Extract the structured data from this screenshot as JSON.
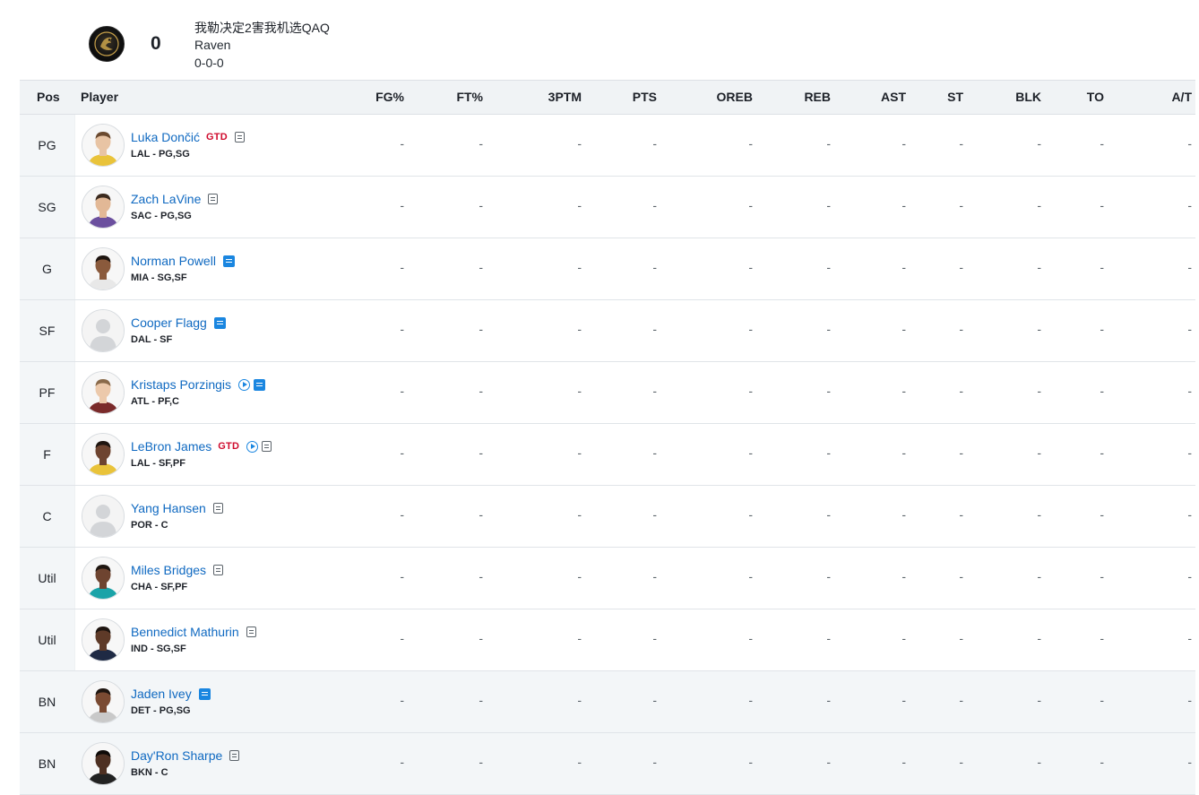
{
  "team": {
    "name": "我勒决定2害我机选QAQ",
    "owner": "Raven",
    "score": "0",
    "record": "0-0-0",
    "logo_icon": "raven-logo-icon"
  },
  "columns": {
    "pos": "Pos",
    "player": "Player",
    "stats": [
      "FG%",
      "FT%",
      "3PTM",
      "PTS",
      "OREB",
      "REB",
      "AST",
      "ST",
      "BLK",
      "TO",
      "A/T"
    ]
  },
  "players": [
    {
      "pos": "PG",
      "name": "Luka Dončić",
      "team_pos": "LAL - PG,SG",
      "status": "GTD",
      "video": false,
      "note": "plain",
      "avatar_bg": "#e9c33a",
      "skin": "#e8c4a4",
      "hair": "#6b4a2f",
      "stats": [
        "-",
        "-",
        "-",
        "-",
        "-",
        "-",
        "-",
        "-",
        "-",
        "-",
        "-"
      ]
    },
    {
      "pos": "SG",
      "name": "Zach LaVine",
      "team_pos": "SAC - PG,SG",
      "status": "",
      "video": false,
      "note": "plain",
      "avatar_bg": "#6b4f9e",
      "skin": "#e2b896",
      "hair": "#3b2a1e",
      "stats": [
        "-",
        "-",
        "-",
        "-",
        "-",
        "-",
        "-",
        "-",
        "-",
        "-",
        "-"
      ]
    },
    {
      "pos": "G",
      "name": "Norman Powell",
      "team_pos": "MIA - SG,SF",
      "status": "",
      "video": false,
      "note": "active",
      "avatar_bg": "#e8e8e8",
      "skin": "#8a5a3c",
      "hair": "#1e1510",
      "stats": [
        "-",
        "-",
        "-",
        "-",
        "-",
        "-",
        "-",
        "-",
        "-",
        "-",
        "-"
      ]
    },
    {
      "pos": "SF",
      "name": "Cooper Flagg",
      "team_pos": "DAL - SF",
      "status": "",
      "video": false,
      "note": "active",
      "avatar_bg": "",
      "skin": "",
      "hair": "",
      "stats": [
        "-",
        "-",
        "-",
        "-",
        "-",
        "-",
        "-",
        "-",
        "-",
        "-",
        "-"
      ]
    },
    {
      "pos": "PF",
      "name": "Kristaps Porzingis",
      "team_pos": "ATL - PF,C",
      "status": "",
      "video": true,
      "note": "active",
      "avatar_bg": "#7a2a2a",
      "skin": "#ecc9ab",
      "hair": "#8a6a4a",
      "stats": [
        "-",
        "-",
        "-",
        "-",
        "-",
        "-",
        "-",
        "-",
        "-",
        "-",
        "-"
      ]
    },
    {
      "pos": "F",
      "name": "LeBron James",
      "team_pos": "LAL - SF,PF",
      "status": "GTD",
      "video": true,
      "note": "plain",
      "avatar_bg": "#e9c33a",
      "skin": "#6e4430",
      "hair": "#1e1510",
      "stats": [
        "-",
        "-",
        "-",
        "-",
        "-",
        "-",
        "-",
        "-",
        "-",
        "-",
        "-"
      ]
    },
    {
      "pos": "C",
      "name": "Yang Hansen",
      "team_pos": "POR - C",
      "status": "",
      "video": false,
      "note": "plain",
      "avatar_bg": "",
      "skin": "",
      "hair": "",
      "stats": [
        "-",
        "-",
        "-",
        "-",
        "-",
        "-",
        "-",
        "-",
        "-",
        "-",
        "-"
      ]
    },
    {
      "pos": "Util",
      "name": "Miles Bridges",
      "team_pos": "CHA - SF,PF",
      "status": "",
      "video": false,
      "note": "plain",
      "avatar_bg": "#1aa3a8",
      "skin": "#6e4430",
      "hair": "#1e1510",
      "stats": [
        "-",
        "-",
        "-",
        "-",
        "-",
        "-",
        "-",
        "-",
        "-",
        "-",
        "-"
      ]
    },
    {
      "pos": "Util",
      "name": "Bennedict Mathurin",
      "team_pos": "IND - SG,SF",
      "status": "",
      "video": false,
      "note": "plain",
      "avatar_bg": "#1f2a44",
      "skin": "#5e3a28",
      "hair": "#1e1510",
      "stats": [
        "-",
        "-",
        "-",
        "-",
        "-",
        "-",
        "-",
        "-",
        "-",
        "-",
        "-"
      ]
    },
    {
      "pos": "BN",
      "name": "Jaden Ivey",
      "team_pos": "DET - PG,SG",
      "status": "",
      "video": false,
      "note": "active",
      "avatar_bg": "#c9c9c9",
      "skin": "#7a4a32",
      "hair": "#1e1510",
      "stats": [
        "-",
        "-",
        "-",
        "-",
        "-",
        "-",
        "-",
        "-",
        "-",
        "-",
        "-"
      ]
    },
    {
      "pos": "BN",
      "name": "Day'Ron Sharpe",
      "team_pos": "BKN - C",
      "status": "",
      "video": false,
      "note": "plain",
      "avatar_bg": "#222222",
      "skin": "#4e3022",
      "hair": "#0e0a08",
      "stats": [
        "-",
        "-",
        "-",
        "-",
        "-",
        "-",
        "-",
        "-",
        "-",
        "-",
        "-"
      ]
    }
  ]
}
